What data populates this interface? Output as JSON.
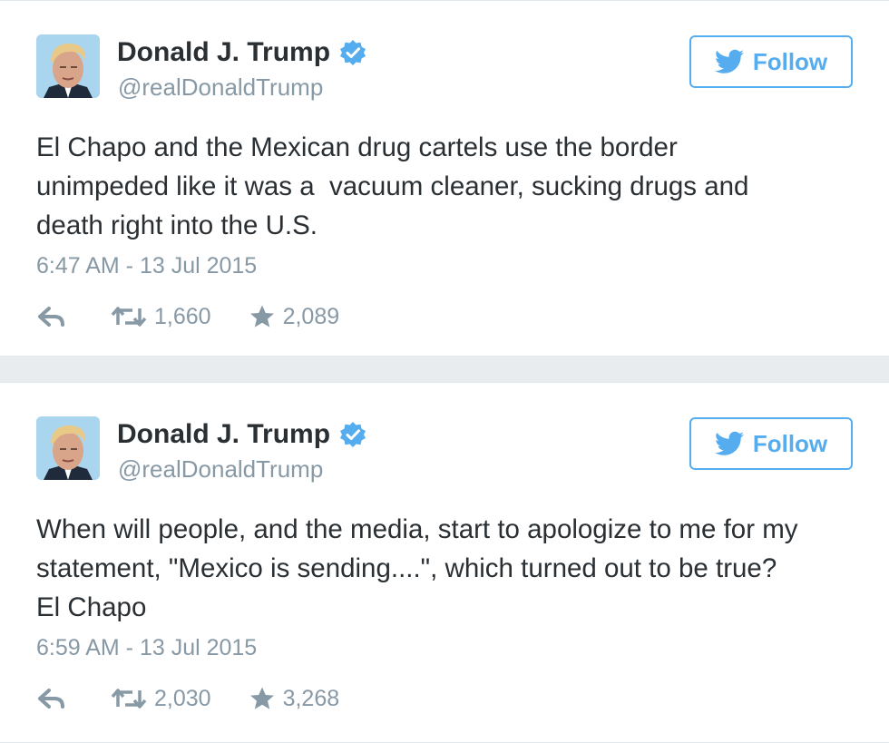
{
  "tweets": [
    {
      "name": "Donald J. Trump",
      "handle": "@realDonaldTrump",
      "follow_label": "Follow",
      "text": "El Chapo and the Mexican drug cartels use the border\nunimpeded like it was a  vacuum cleaner, sucking drugs and\ndeath right into the U.S.",
      "timestamp": "6:47 AM - 13 Jul 2015",
      "retweets": "1,660",
      "favorites": "2,089"
    },
    {
      "name": "Donald J. Trump",
      "handle": "@realDonaldTrump",
      "follow_label": "Follow",
      "text": "When will people, and the media, start to apologize to me for my\nstatement, \"Mexico is sending....\", which turned out to be true?\nEl Chapo",
      "timestamp": "6:59 AM - 13 Jul 2015",
      "retweets": "2,030",
      "favorites": "3,268"
    }
  ],
  "icons": {
    "verified": "verified-badge-icon",
    "follow": "twitter-bird-icon",
    "reply": "reply-icon",
    "retweet": "retweet-icon",
    "favorite": "star-icon"
  },
  "colors": {
    "accent": "#55acee",
    "muted": "#8899a6",
    "text": "#292f33",
    "verified": "#55acee"
  }
}
